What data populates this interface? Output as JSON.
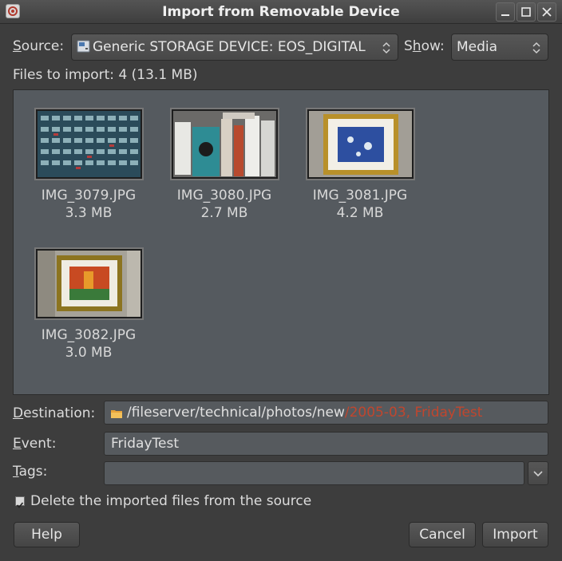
{
  "window": {
    "title": "Import from Removable Device"
  },
  "source": {
    "label": "Source:",
    "value": "Generic STORAGE DEVICE: EOS_DIGITAL",
    "icon": "drive-icon"
  },
  "show": {
    "label": "Show:",
    "value": "Media"
  },
  "summary": "Files to import: 4 (13.1 MB)",
  "files": [
    {
      "name": "IMG_3079.JPG",
      "size": "3.3 MB"
    },
    {
      "name": "IMG_3080.JPG",
      "size": "2.7 MB"
    },
    {
      "name": "IMG_3081.JPG",
      "size": "4.2 MB"
    },
    {
      "name": "IMG_3082.JPG",
      "size": "3.0 MB"
    }
  ],
  "destination": {
    "label": "Destination:",
    "path": "/fileserver/technical/photos/new",
    "suffix": "/2005-03, FridayTest",
    "accent": "#c0462e"
  },
  "event": {
    "label": "Event:",
    "value": "FridayTest"
  },
  "tags": {
    "label": "Tags:",
    "value": ""
  },
  "delete_option": {
    "label": "Delete the imported files from the source",
    "checked": true
  },
  "buttons": {
    "help": "Help",
    "cancel": "Cancel",
    "import": "Import"
  }
}
